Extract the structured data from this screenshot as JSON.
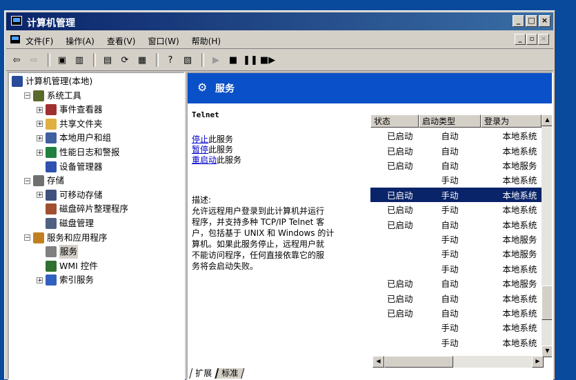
{
  "window": {
    "title": "计算机管理"
  },
  "menu": [
    "文件(F)",
    "操作(A)",
    "查看(V)",
    "窗口(W)",
    "帮助(H)"
  ],
  "tree": [
    {
      "label": "计算机管理(本地)",
      "level": 0,
      "expander": "",
      "icon": "computer-icon"
    },
    {
      "label": "系统工具",
      "level": 1,
      "expander": "−",
      "icon": "tools-icon"
    },
    {
      "label": "事件查看器",
      "level": 2,
      "expander": "+",
      "icon": "event-viewer-icon"
    },
    {
      "label": "共享文件夹",
      "level": 2,
      "expander": "+",
      "icon": "folder-icon"
    },
    {
      "label": "本地用户和组",
      "level": 2,
      "expander": "+",
      "icon": "users-icon"
    },
    {
      "label": "性能日志和警报",
      "level": 2,
      "expander": "+",
      "icon": "performance-icon"
    },
    {
      "label": "设备管理器",
      "level": 2,
      "expander": "",
      "icon": "device-manager-icon"
    },
    {
      "label": "存储",
      "level": 1,
      "expander": "−",
      "icon": "storage-icon"
    },
    {
      "label": "可移动存储",
      "level": 2,
      "expander": "+",
      "icon": "removable-storage-icon"
    },
    {
      "label": "磁盘碎片整理程序",
      "level": 2,
      "expander": "",
      "icon": "defrag-icon"
    },
    {
      "label": "磁盘管理",
      "level": 2,
      "expander": "",
      "icon": "disk-management-icon"
    },
    {
      "label": "服务和应用程序",
      "level": 1,
      "expander": "−",
      "icon": "services-apps-icon"
    },
    {
      "label": "服务",
      "level": 2,
      "expander": "",
      "icon": "gear-icon",
      "selected": true
    },
    {
      "label": "WMI 控件",
      "level": 2,
      "expander": "",
      "icon": "wmi-icon"
    },
    {
      "label": "索引服务",
      "level": 2,
      "expander": "+",
      "icon": "index-icon"
    }
  ],
  "right_header": "服务",
  "service": {
    "name": "Telnet",
    "actions": [
      {
        "link": "停止",
        "suffix": "此服务"
      },
      {
        "link": "暂停",
        "suffix": "此服务"
      },
      {
        "link": "重启动",
        "suffix": "此服务"
      }
    ],
    "desc_label": "描述:",
    "desc_lines": [
      "允许远程用户登录到此计算机并运行",
      "程序，并支持多种 TCP/IP Telnet 客",
      "户，包括基于 UNIX 和 Windows 的计",
      "算机。如果此服务停止，远程用户就",
      "不能访问程序，任何直接依靠它的服",
      "务将会启动失败。"
    ]
  },
  "columns": [
    "状态",
    "启动类型",
    "登录为"
  ],
  "rows": [
    {
      "status": "已启动",
      "startup": "自动",
      "logon": "本地系统"
    },
    {
      "status": "已启动",
      "startup": "自动",
      "logon": "本地系统"
    },
    {
      "status": "已启动",
      "startup": "自动",
      "logon": "本地服务"
    },
    {
      "status": "",
      "startup": "手动",
      "logon": "本地系统"
    },
    {
      "status": "已启动",
      "startup": "手动",
      "logon": "本地系统",
      "selected": true
    },
    {
      "status": "已启动",
      "startup": "手动",
      "logon": "本地系统"
    },
    {
      "status": "已启动",
      "startup": "自动",
      "logon": "本地系统"
    },
    {
      "status": "",
      "startup": "手动",
      "logon": "本地服务"
    },
    {
      "status": "",
      "startup": "手动",
      "logon": "本地服务"
    },
    {
      "status": "",
      "startup": "手动",
      "logon": "本地系统"
    },
    {
      "status": "已启动",
      "startup": "自动",
      "logon": "本地服务"
    },
    {
      "status": "已启动",
      "startup": "自动",
      "logon": "本地系统"
    },
    {
      "status": "已启动",
      "startup": "自动",
      "logon": "本地系统"
    },
    {
      "status": "",
      "startup": "手动",
      "logon": "本地系统"
    },
    {
      "status": "",
      "startup": "手动",
      "logon": "本地系统"
    }
  ],
  "tabs": [
    "扩展",
    "标准"
  ]
}
